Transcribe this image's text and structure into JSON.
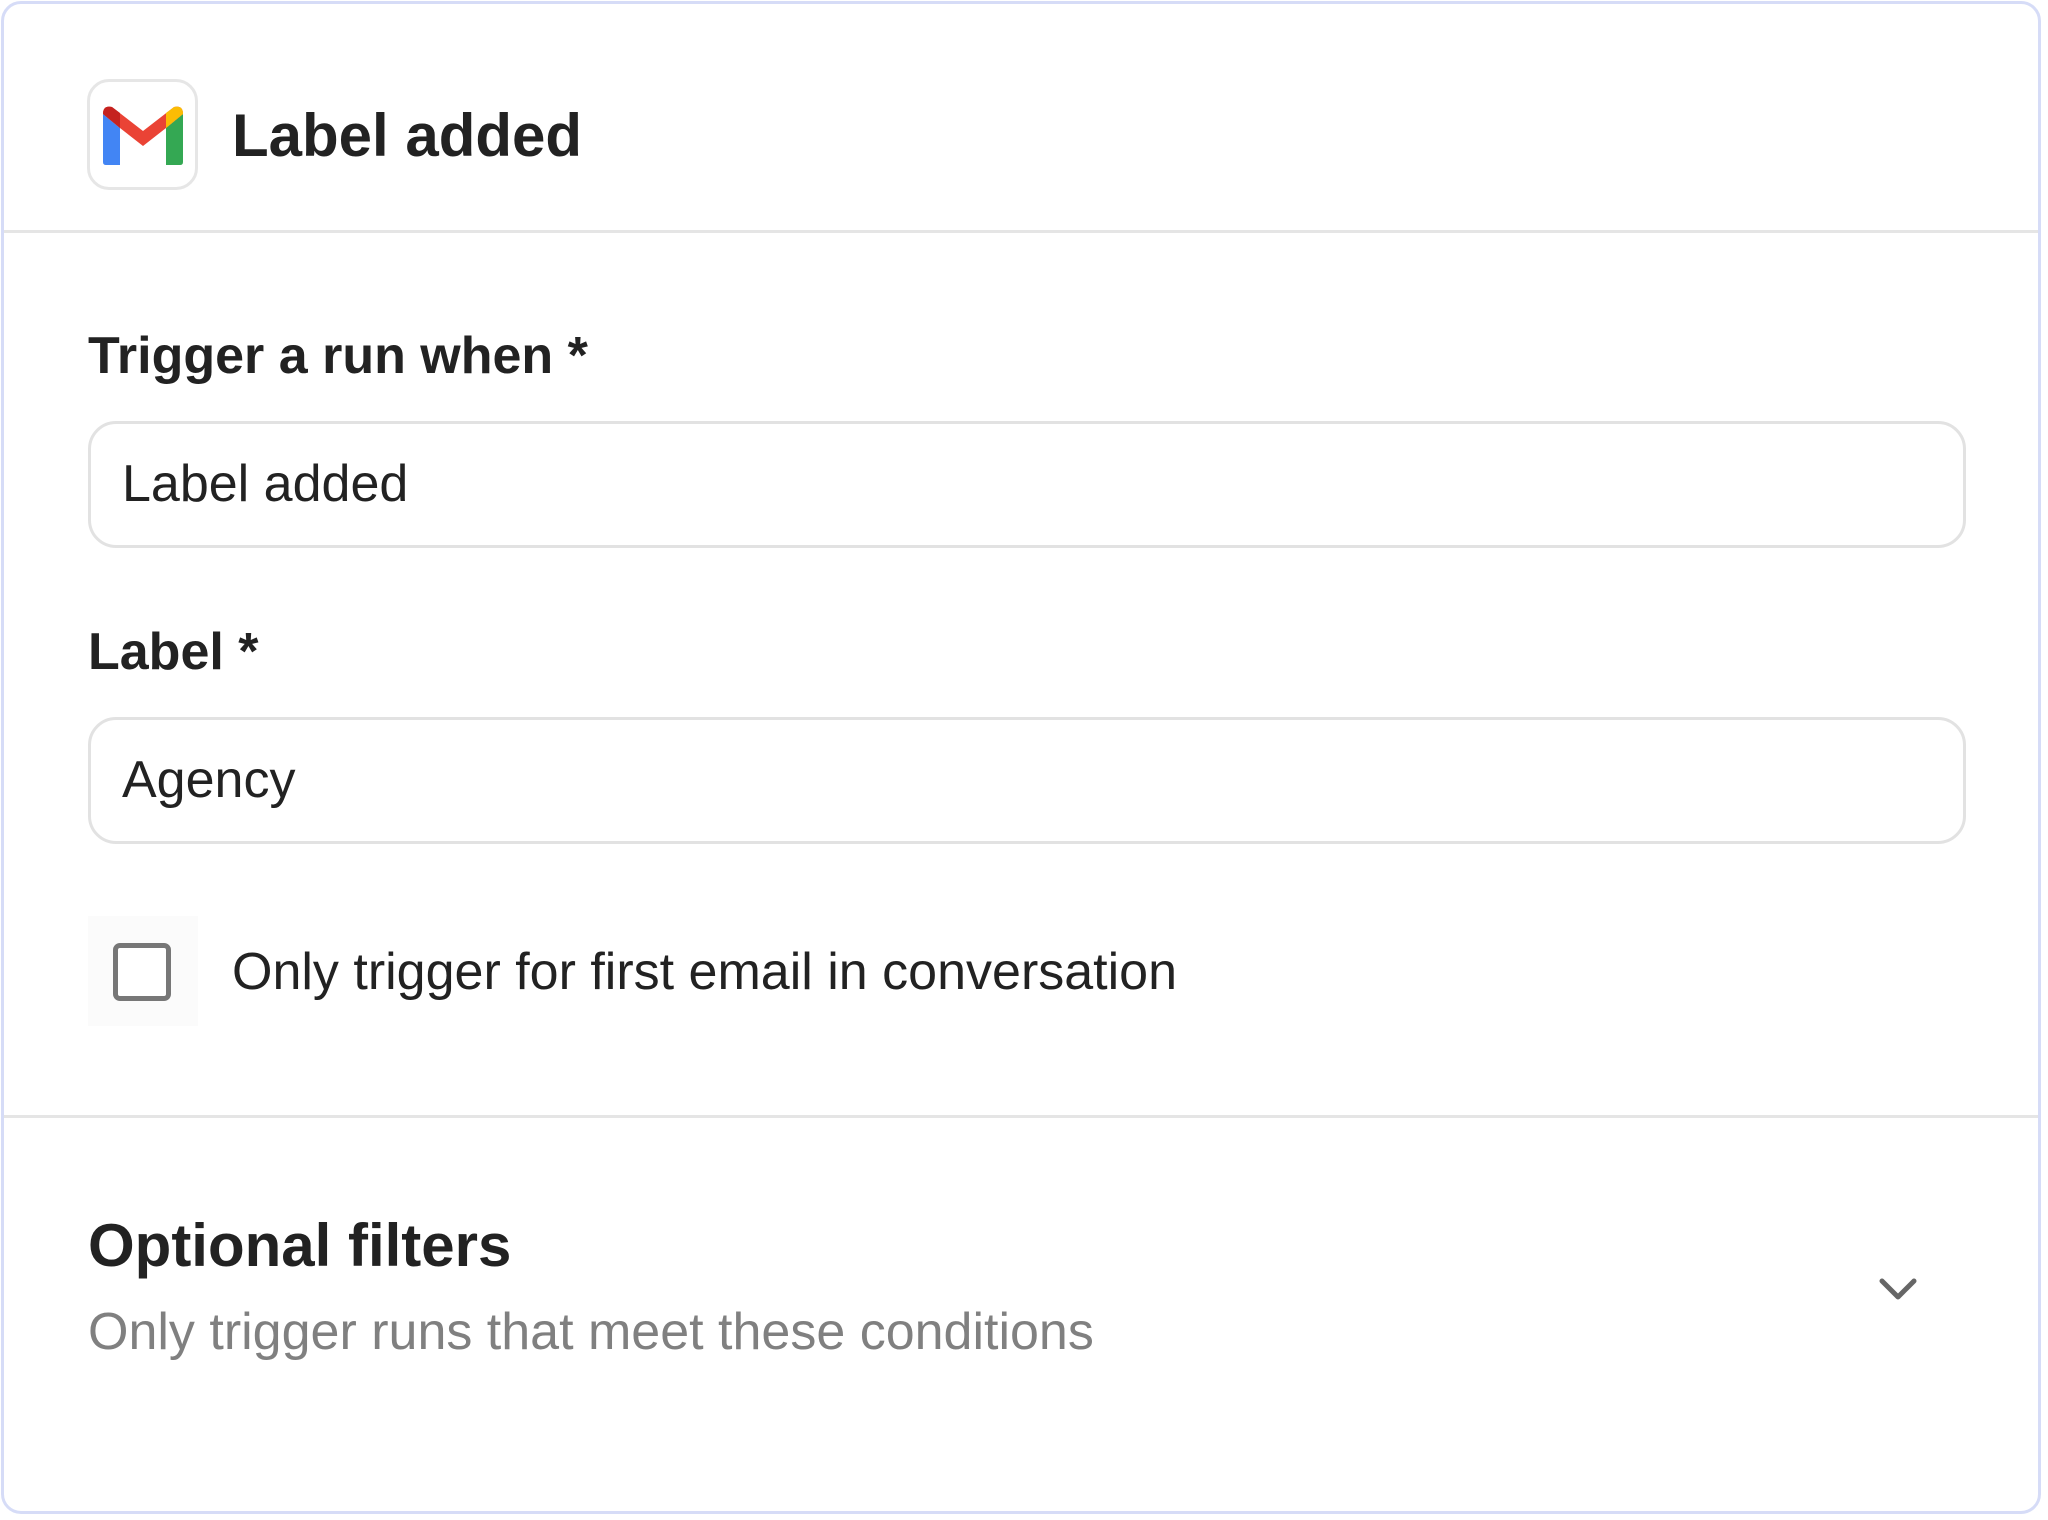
{
  "header": {
    "title": "Label added",
    "app_icon": "gmail-icon"
  },
  "trigger_field": {
    "label": "Trigger a run when *",
    "value": "Label added"
  },
  "label_field": {
    "label": "Label *",
    "value": "Agency"
  },
  "first_email_option": {
    "label": "Only trigger for first email in conversation",
    "checked": false
  },
  "filters": {
    "title": "Optional filters",
    "subtitle": "Only trigger runs that meet these conditions",
    "toggle_icon": "chevron-down-icon"
  },
  "colors": {
    "panel_border": "#d6dcf7",
    "text": "#222222",
    "muted_text": "#808080",
    "gmail_red": "#ea4335",
    "gmail_blue": "#4285f4",
    "gmail_green": "#34a853",
    "gmail_yellow": "#fbbc04"
  }
}
